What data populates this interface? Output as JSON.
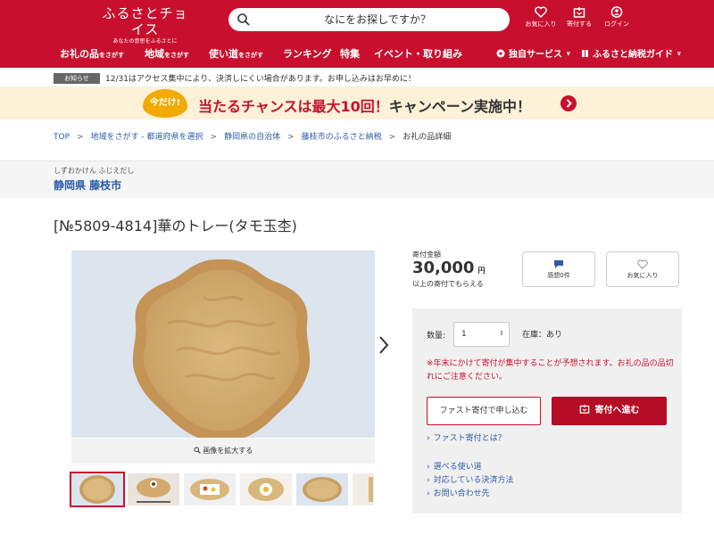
{
  "header": {
    "logo_main": "ふるさとチョイス",
    "logo_sub": "あなたの意思をふるさとに",
    "search_placeholder": "なにをお探しですか？",
    "favorite_label": "お気に入り",
    "donate_label": "寄付する",
    "login_label": "ログイン",
    "accent": "#c8102e"
  },
  "nav": {
    "items": [
      {
        "label": "お礼の品",
        "small": "をさがす"
      },
      {
        "label": "地域",
        "small": "をさがす"
      },
      {
        "label": "使い道",
        "small": "をさがす"
      },
      {
        "label": "ランキング",
        "small": ""
      },
      {
        "label": "特集",
        "small": ""
      },
      {
        "label": "イベント・取り組み",
        "small": ""
      }
    ],
    "right_items": [
      "独自サービス",
      "ふるさと納税ガイド"
    ]
  },
  "notice": {
    "tag": "お知らせ",
    "text": "12/31はアクセス集中により、決済しにくい場合があります。お申し込みはお早めに！"
  },
  "banner": {
    "bubble": "今だけ!",
    "text_red": "当たるチャンスは最大10回！",
    "text_dark": "キャンペーン実施中！"
  },
  "breadcrumb": [
    "TOP",
    "地域をさがす - 都道府県を選択",
    "静岡県の自治体",
    "藤枝市のふるさと納税",
    "お礼の品詳細"
  ],
  "region": {
    "ruby": "しずおかけん ふじえだし",
    "name": "静岡県 藤枝市"
  },
  "product": {
    "title": "[№5809-4814]華のトレー(タモ玉杢)",
    "zoom_label": "画像を拡大する",
    "price_label": "寄付金額",
    "price": "30,000",
    "price_unit": "円",
    "price_note": "以上の寄付でもらえる",
    "review_label": "感想0件",
    "favorite_label": "お気に入り"
  },
  "panel": {
    "qty_label": "数量:",
    "qty_value": "1",
    "stock": "在庫：あり",
    "warning": "※年末にかけて寄付が集中することが予想されます。お礼の品の品切れにご注意ください。",
    "fast_button": "ファスト寄付で申し込む",
    "go_button": "寄付へ進む",
    "fast_link": "ファスト寄付とは？",
    "links": [
      "選べる使い道",
      "対応している決済方法",
      "お問い合わせ先"
    ]
  }
}
